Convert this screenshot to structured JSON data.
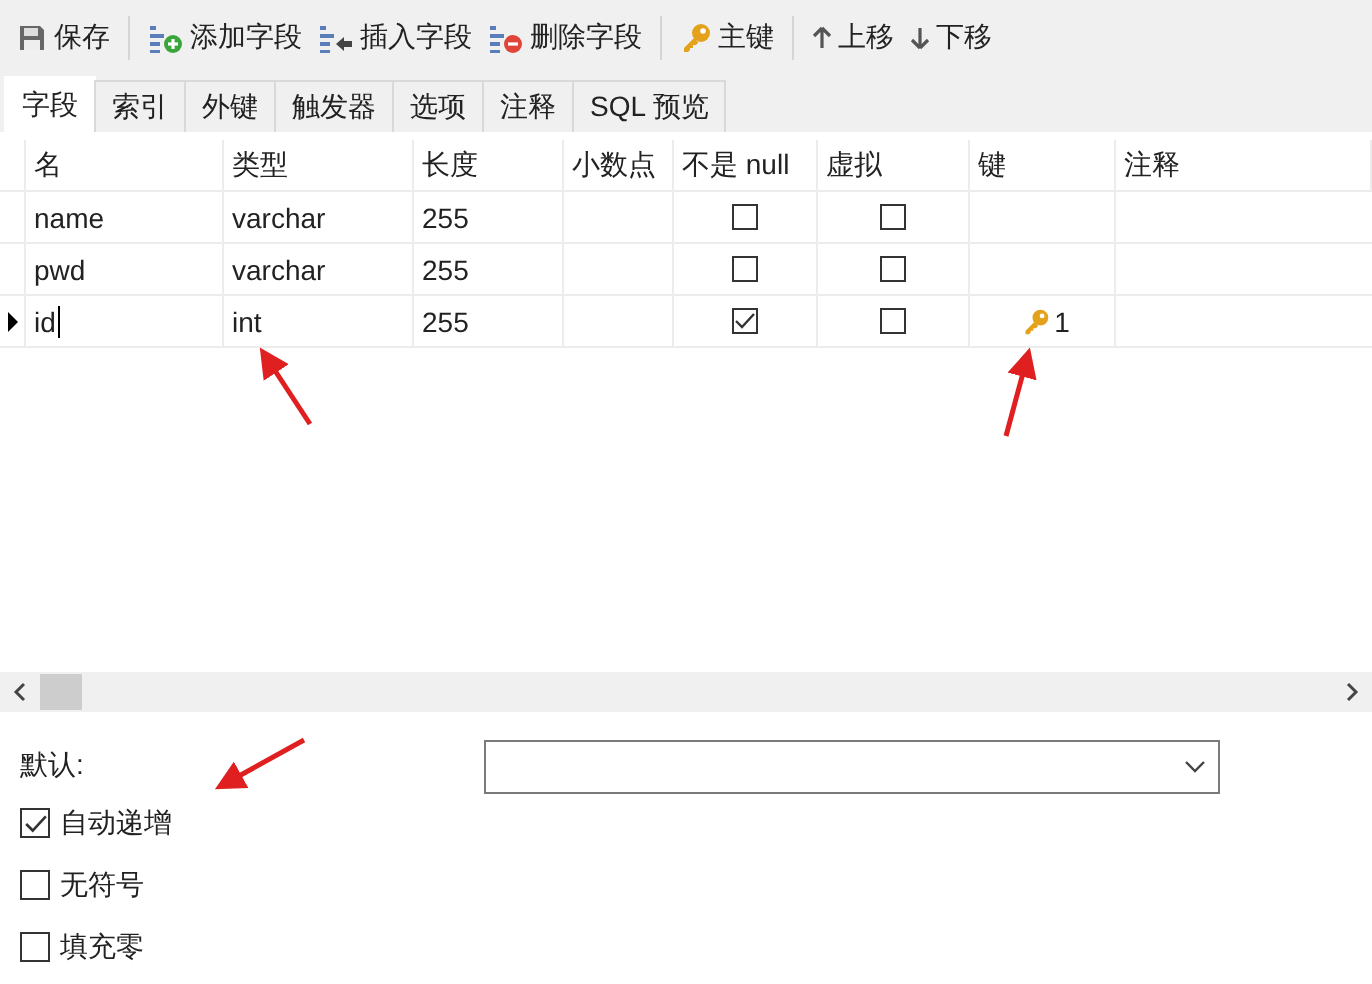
{
  "toolbar": [
    [
      {
        "kind": "save",
        "label": "保存"
      }
    ],
    [
      {
        "kind": "add",
        "label": "添加字段"
      },
      {
        "kind": "insert",
        "label": "插入字段"
      },
      {
        "kind": "delete",
        "label": "删除字段"
      }
    ],
    [
      {
        "kind": "key",
        "label": "主键"
      }
    ],
    [
      {
        "kind": "up",
        "label": "上移"
      },
      {
        "kind": "down",
        "label": "下移"
      }
    ]
  ],
  "tabs": [
    {
      "label": "字段",
      "selected": true
    },
    {
      "label": "索引",
      "selected": false
    },
    {
      "label": "外键",
      "selected": false
    },
    {
      "label": "触发器",
      "selected": false
    },
    {
      "label": "选项",
      "selected": false
    },
    {
      "label": "注释",
      "selected": false
    },
    {
      "label": "SQL 预览",
      "selected": false
    }
  ],
  "table": {
    "columns": [
      "名",
      "类型",
      "长度",
      "小数点",
      "不是 null",
      "虚拟",
      "键",
      "注释"
    ],
    "rows": [
      {
        "current": false,
        "name": "name",
        "type": "varchar",
        "length": "255",
        "not_null": false,
        "virtual": false,
        "primary_key": false
      },
      {
        "current": false,
        "name": "pwd",
        "type": "varchar",
        "length": "255",
        "not_null": false,
        "virtual": false,
        "primary_key": false
      },
      {
        "current": true,
        "name": "id",
        "type": "int",
        "length": "255",
        "not_null": true,
        "virtual": false,
        "primary_key": true,
        "key_order": "1"
      }
    ]
  },
  "properties": {
    "default_label": "默认:",
    "options": [
      {
        "label": "自动递增",
        "checked": true
      },
      {
        "label": "无符号",
        "checked": false
      },
      {
        "label": "填充零",
        "checked": false
      }
    ]
  }
}
